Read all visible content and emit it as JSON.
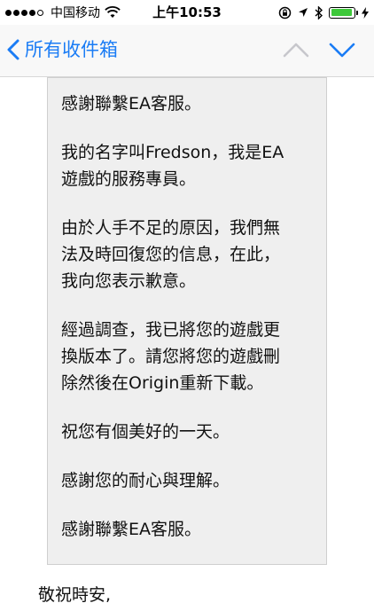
{
  "status_bar": {
    "carrier": "中国移动",
    "time": "上午10:53",
    "signal_dots_filled": 4,
    "signal_dots_total": 5,
    "battery_level": 0.95,
    "battery_color": "#3ec83a",
    "icons": [
      "wifi-icon",
      "rotation-lock-icon",
      "location-icon",
      "bluetooth-icon",
      "battery-icon",
      "charging-icon"
    ]
  },
  "nav": {
    "back_label": "所有收件箱",
    "accent_color": "#1a7cf5",
    "icons": [
      "chevron-left-icon",
      "chevron-up-icon",
      "chevron-down-icon"
    ]
  },
  "message": {
    "quoted_paragraphs": [
      "感謝聯繫EA客服。",
      "我的名字叫Fredson，我是EA\n遊戲的服務專員。",
      "由於人手不足的原因，我們無\n法及時回復您的信息，在此，\n我向您表示歉意。",
      "經過調查，我已將您的遊戲更\n換版本了。請您將您的遊戲刪\n除然後在Origin重新下載。",
      "祝您有個美好的一天。",
      "感謝您的耐心與理解。",
      "感謝聯繫EA客服。"
    ],
    "closing": "敬祝時安,"
  }
}
